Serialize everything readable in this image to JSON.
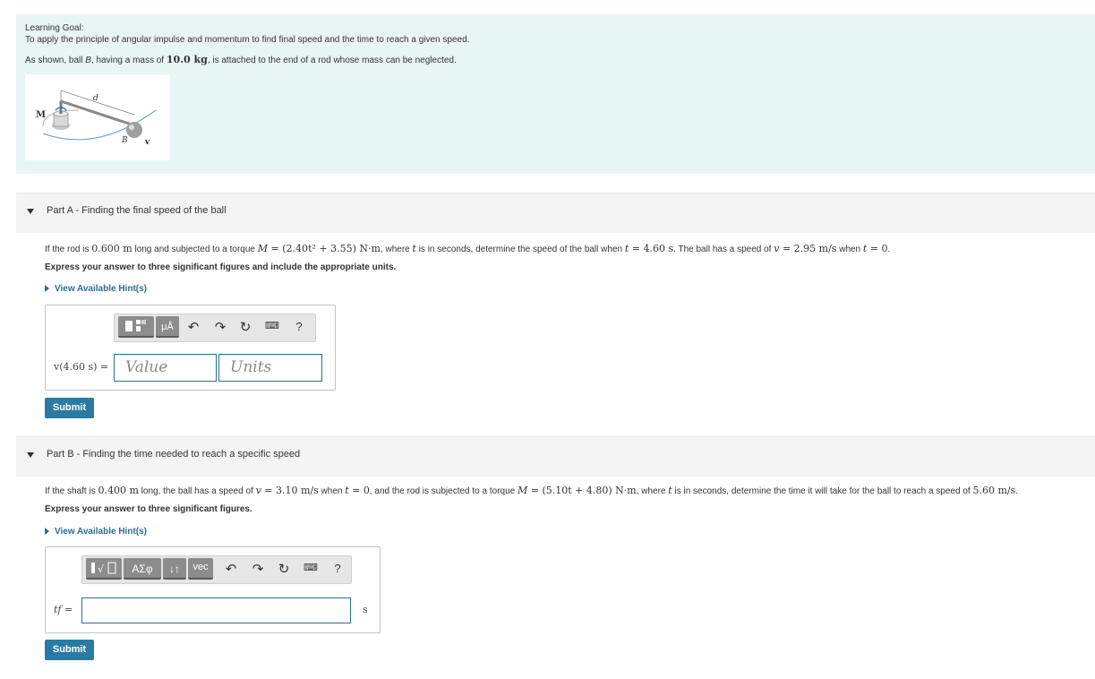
{
  "goal": {
    "heading": "Learning Goal:",
    "text": "To apply the principle of angular impulse and momentum to find final speed and the time to reach a given speed.",
    "intro_a": "As shown, ball ",
    "intro_b": "B",
    "intro_c": ", having a mass of ",
    "intro_mass": "10.0 kg",
    "intro_d": ", is attached to the end of a rod whose mass can be neglected.",
    "figure": {
      "label_M": "M",
      "label_d": "d",
      "label_B": "B",
      "label_v": "v"
    }
  },
  "partA": {
    "title": "Part A - Finding the final speed of the ball",
    "q1": "If the rod is ",
    "q_len": "0.600 m",
    "q2": " long and subjected to a torque ",
    "q_M": "M",
    "q_eq": " = ",
    "q_torque": "(2.40t² + 3.55) N·m",
    "q3": ", where ",
    "q_t": "t",
    "q4": " is in seconds, determine the speed of the ball when ",
    "q_t2": "t",
    "q_tval": " = 4.60 s",
    "q5": ". The ball has a speed of ",
    "q_v": "v",
    "q_vval": " = 2.95 m/s",
    "q6": " when ",
    "q_t3": "t",
    "q_t0": " = 0",
    "q7": ".",
    "instruction": "Express your answer to three significant figures and include the appropriate units.",
    "hint": "View Available Hint(s)",
    "toolbar": {
      "mu_label": "μÅ",
      "help": "?"
    },
    "answer_label": "v(4.60 s) =",
    "value_placeholder": "Value",
    "units_placeholder": "Units",
    "submit": "Submit"
  },
  "partB": {
    "title": "Part B - Finding the time needed to reach a specific speed",
    "q1": "If the shaft is ",
    "q_len": "0.400 m",
    "q2": " long, the ball has a speed of ",
    "q_v": "v",
    "q_vval": " = 3.10 m/s",
    "q3": " when ",
    "q_t": "t",
    "q_t0": " = 0",
    "q4": ", and the rod is subjected to a torque ",
    "q_M": "M",
    "q_eq": " = ",
    "q_torque": "(5.10t + 4.80) N·m",
    "q5": ", where ",
    "q_t2": "t",
    "q6": " is in seconds, determine the time it will take for the ball to reach a speed of ",
    "q_target": "5.60 m/s",
    "q7": ".",
    "instruction": "Express your answer to three significant figures.",
    "hint": "View Available Hint(s)",
    "toolbar": {
      "greek": "ΑΣφ",
      "arrows": "↓↑",
      "vec": "vec",
      "help": "?"
    },
    "answer_label": "tf =",
    "unit": "s",
    "submit": "Submit"
  }
}
